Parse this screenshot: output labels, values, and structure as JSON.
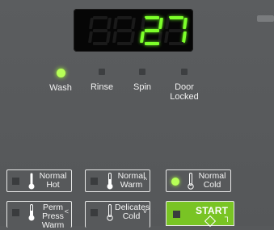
{
  "display": {
    "digits": [
      "8",
      "8",
      "2",
      "7"
    ],
    "lit": [
      false,
      false,
      true,
      true
    ]
  },
  "colors": {
    "panel": "#57595b",
    "led_on": "#b7ff57",
    "display_on": "#7dff2a",
    "start": "#79c424"
  },
  "status_lights": [
    {
      "label": "Wash",
      "on": true
    },
    {
      "label": "Rinse",
      "on": false
    },
    {
      "label": "Spin",
      "on": false
    },
    {
      "label": "Door\nLocked",
      "on": false
    }
  ],
  "buttons": [
    {
      "label": "Normal\nHot",
      "icon": "thermometer-full-icon",
      "selected": false
    },
    {
      "label": "Normal\nWarm",
      "icon": "thermometer-half-icon",
      "selected": false,
      "arrow": "^"
    },
    {
      "label": "Normal\nCold",
      "icon": "thermometer-empty-icon",
      "selected": true
    },
    {
      "label": "Perm\nPress\nWarm",
      "icon": "thermometer-half-icon",
      "selected": false,
      "arrow": "<"
    },
    {
      "label": "Delicates\nCold",
      "icon": "thermometer-empty-icon",
      "selected": false,
      "arrow": "˅"
    }
  ],
  "start": {
    "label": "START",
    "icon": "start-diamond-icon"
  }
}
